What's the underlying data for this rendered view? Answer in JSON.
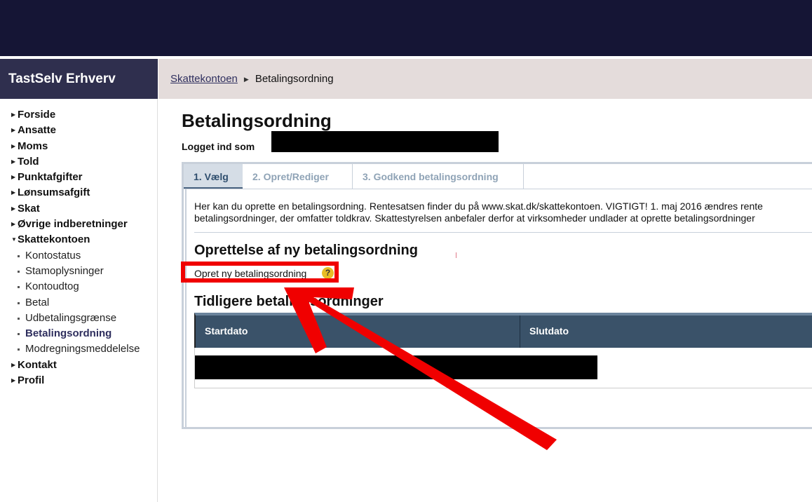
{
  "app": {
    "brand": "TastSelv Erhverv"
  },
  "breadcrumb": {
    "parent": "Skattekontoen",
    "current": "Betalingsordning"
  },
  "sidebar": {
    "items": [
      {
        "label": "Forside"
      },
      {
        "label": "Ansatte"
      },
      {
        "label": "Moms"
      },
      {
        "label": "Told"
      },
      {
        "label": "Punktafgifter"
      },
      {
        "label": "Lønsumsafgift"
      },
      {
        "label": "Skat"
      },
      {
        "label": "Øvrige indberetninger"
      },
      {
        "label": "Skattekontoen"
      }
    ],
    "subitems": [
      {
        "label": "Kontostatus"
      },
      {
        "label": "Stamoplysninger"
      },
      {
        "label": "Kontoudtog"
      },
      {
        "label": "Betal"
      },
      {
        "label": "Udbetalingsgrænse"
      },
      {
        "label": "Betalingsordning"
      },
      {
        "label": "Modregningsmeddelelse"
      }
    ],
    "items_after": [
      {
        "label": "Kontakt"
      },
      {
        "label": "Profil"
      }
    ]
  },
  "page": {
    "title": "Betalingsordning",
    "logged_in_label": "Logget ind som"
  },
  "tabs": [
    {
      "label": "1. Vælg"
    },
    {
      "label": "2. Opret/Rediger"
    },
    {
      "label": "3. Godkend betalingsordning"
    }
  ],
  "intro": {
    "line1": "Her kan du oprette en betalingsordning. Rentesatsen finder du på www.skat.dk/skattekontoen. VIGTIGT! 1. maj 2016 ændres rente",
    "line2": "betalingsordninger, der omfatter toldkrav. Skattestyrelsen anbefaler derfor at virksomheder undlader at oprette betalingsordninger"
  },
  "new_section": {
    "heading": "Oprettelse af ny betalingsordning",
    "link": "Opret ny betalingsordning",
    "help": "?"
  },
  "previous": {
    "heading": "Tidligere betalingsordninger",
    "columns": [
      "Startdato",
      "Slutdato"
    ]
  },
  "colors": {
    "topbar": "#151535",
    "brand_bg": "#2f2f4e",
    "table_header": "#3a5269",
    "annotation": "#f00000"
  }
}
